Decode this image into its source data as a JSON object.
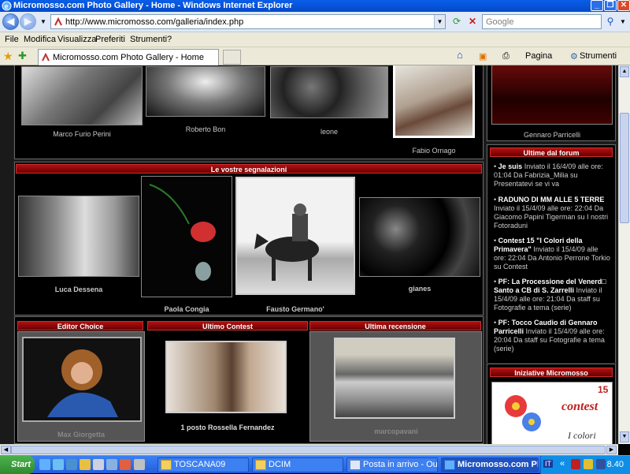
{
  "window": {
    "title": "Micromosso.com Photo Gallery - Home - Windows Internet Explorer"
  },
  "address": {
    "url": "http://www.micromosso.com/galleria/index.php"
  },
  "search": {
    "placeholder": "Google"
  },
  "menu": [
    "File",
    "Modifica",
    "Visualizza",
    "Preferiti",
    "Strumenti",
    "?"
  ],
  "tab": {
    "title": "Micromosso.com Photo Gallery - Home"
  },
  "toolbar": {
    "page": "Pagina",
    "tools": "Strumenti"
  },
  "top_gallery": {
    "captions": [
      "Marco Furio Perini",
      "Roberto Bon",
      "leone",
      "Fabio Ornago"
    ]
  },
  "segnalazioni": {
    "header": "Le vostre segnalazioni",
    "captions": [
      "Luca Dessena",
      "Paola Congia",
      "Fausto Germano'",
      "gianes"
    ]
  },
  "editor": {
    "header": "Editor Choice",
    "caption": "Max Giorgetta"
  },
  "contest": {
    "header": "Ultimo Contest",
    "caption": "1 posto Rossella Fernandez"
  },
  "recensione": {
    "header": "Ultima recensione",
    "caption": "marcopavani"
  },
  "sidebar": {
    "top_caption": "Gennaro Parricelli",
    "forum_header": "Ultime dal forum",
    "forum": [
      {
        "title": "Je suis",
        "text": "Inviato il 16/4/09 alle ore: 01:04 Da Fabrizia_Milia su Presentatevi se vi va"
      },
      {
        "title": "RADUNO DI MM ALLE 5 TERRE",
        "text": "Inviato il 15/4/09 alle ore: 22:04 Da Giacomo Papini Tigerman su I nostri Fotoraduni"
      },
      {
        "title": "Contest 15 \"I Colori della Primavera\"",
        "text": "Inviato il 15/4/09 alle ore: 22:04 Da Antonio Perrone Torkio su Contest"
      },
      {
        "title": "PF: La Processione del Venerd□ Santo a CB di S. Zarrelli",
        "text": "Inviato il 15/4/09 alle ore: 21:04 Da staff su Fotografie a tema (serie)"
      },
      {
        "title": "PF: Tocco Caudio di Gennaro Parricelli",
        "text": "Inviato il 15/4/09 alle ore: 20:04 Da staff su Fotografie a tema (serie)"
      }
    ],
    "initiatives_header": "Iniziative Micromosso",
    "banner_number": "15",
    "banner_word": "contest",
    "banner_sub": "I colori"
  },
  "taskbar": {
    "start": "Start",
    "tasks": [
      "TOSCANA09",
      "DCIM",
      "Posta in arrivo - Outlo...",
      "Micromosso.com Ph..."
    ],
    "clock": "8.40",
    "lang": "IT"
  }
}
